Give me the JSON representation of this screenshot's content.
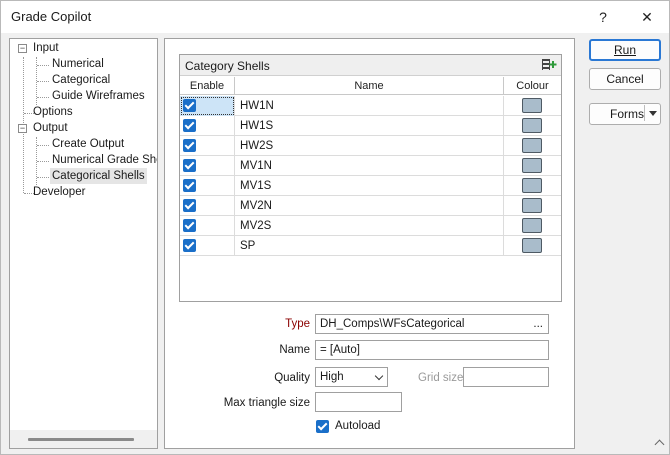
{
  "window": {
    "title": "Grade Copilot",
    "help_label": "?",
    "close_label": "✕"
  },
  "tree": {
    "items": [
      {
        "label": "Input",
        "expander": "−"
      },
      {
        "label": "Numerical"
      },
      {
        "label": "Categorical"
      },
      {
        "label": "Guide Wireframes"
      },
      {
        "label": "Options"
      },
      {
        "label": "Output",
        "expander": "−"
      },
      {
        "label": "Create Output"
      },
      {
        "label": "Numerical Grade Shell"
      },
      {
        "label": "Categorical Shells",
        "selected": true
      },
      {
        "label": "Developer"
      }
    ]
  },
  "grid": {
    "title": "Category Shells",
    "add_icon": "add-row-icon",
    "columns": [
      "Enable",
      "Name",
      "Colour"
    ],
    "rows": [
      {
        "enabled": true,
        "name": "HW1N",
        "colour": "#a9bccb"
      },
      {
        "enabled": true,
        "name": "HW1S",
        "colour": "#a9bccb"
      },
      {
        "enabled": true,
        "name": "HW2S",
        "colour": "#a9bccb"
      },
      {
        "enabled": true,
        "name": "MV1N",
        "colour": "#a9bccb"
      },
      {
        "enabled": true,
        "name": "MV1S",
        "colour": "#a9bccb"
      },
      {
        "enabled": true,
        "name": "MV2N",
        "colour": "#a9bccb"
      },
      {
        "enabled": true,
        "name": "MV2S",
        "colour": "#a9bccb"
      },
      {
        "enabled": true,
        "name": "SP",
        "colour": "#a9bccb"
      }
    ]
  },
  "properties": {
    "type_label": "Type",
    "type_value": "DH_Comps\\WFsCategorical",
    "type_browse": "...",
    "name_label": "Name",
    "name_value": "=   [Auto]",
    "quality_label": "Quality",
    "quality_value": "High",
    "grid_size_label": "Grid size",
    "grid_size_value": "",
    "max_triangle_label": "Max triangle size",
    "max_triangle_value": "",
    "autoload_label": "Autoload",
    "autoload_checked": true
  },
  "buttons": {
    "run": "Run",
    "cancel": "Cancel",
    "forms": "Forms"
  },
  "colors": {
    "accent": "#1a6fc9",
    "default_button_border": "#2a78d4",
    "type_label": "#8b0000",
    "swatch": "#a9bccb"
  }
}
